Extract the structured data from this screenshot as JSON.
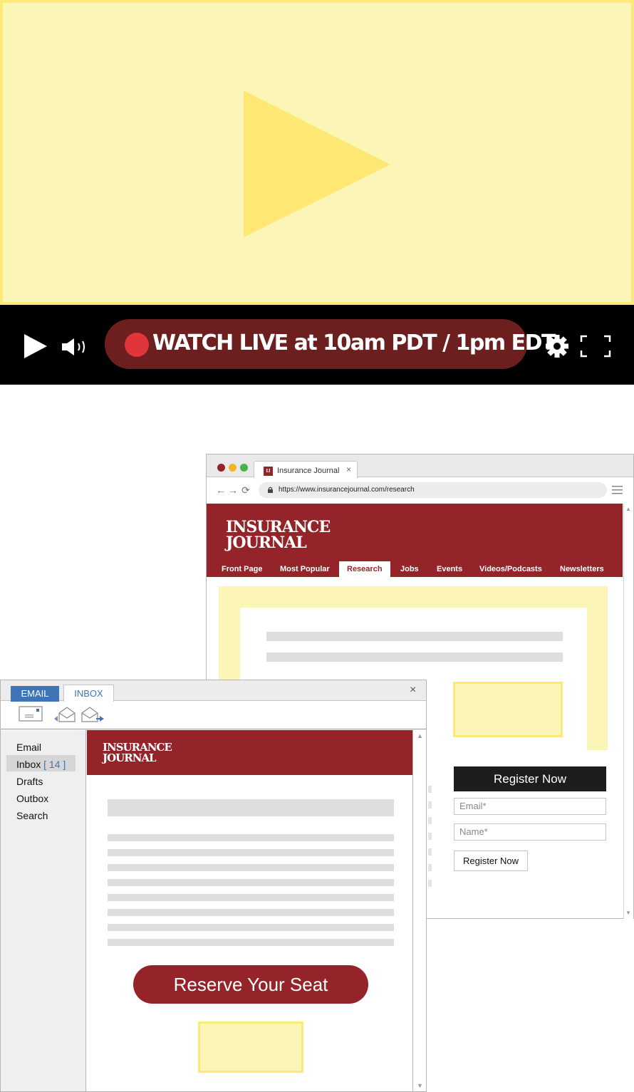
{
  "video_player": {
    "live_label": "WATCH LIVE at 10am PDT / 1pm EDT",
    "icons": [
      "play-large-icon",
      "play-icon",
      "volume-icon",
      "record-icon",
      "gear-icon",
      "fullscreen-icon"
    ],
    "colors": {
      "screen": "#fbf5b8",
      "bar": "#000000",
      "pill": "#6d1e1f",
      "live_dot": "#e0363a"
    }
  },
  "browser": {
    "tab_title": "Insurance Journal",
    "tab_favicon": "IJ",
    "tab_close": "×",
    "url": "https://www.insurancejournal.com/research",
    "logo_line1": "INSURANCE",
    "logo_line2": "JOURNAL",
    "nav": [
      "Front Page",
      "Most Popular",
      "Research",
      "Jobs",
      "Events",
      "Videos/Podcasts",
      "Newsletters"
    ],
    "active_nav": "Research",
    "register_heading_button": "Register Now",
    "email_placeholder": "Email*",
    "name_placeholder": "Name*",
    "register_button": "Register Now",
    "colors": {
      "brand": "#95242a",
      "dark_button": "#1d1d1f"
    }
  },
  "email_client": {
    "tab_email": "EMAIL",
    "tab_inbox": "INBOX",
    "close": "×",
    "folders": {
      "email": "Email",
      "inbox": "Inbox",
      "inbox_count": "[ 14 ]",
      "drafts": "Drafts",
      "outbox": "Outbox",
      "search": "Search"
    },
    "selected_folder": "Inbox",
    "logo_line1": "INSURANCE",
    "logo_line2": "JOURNAL",
    "cta": "Reserve Your Seat",
    "colors": {
      "tab": "#3f74b6",
      "brand": "#95242a"
    }
  }
}
